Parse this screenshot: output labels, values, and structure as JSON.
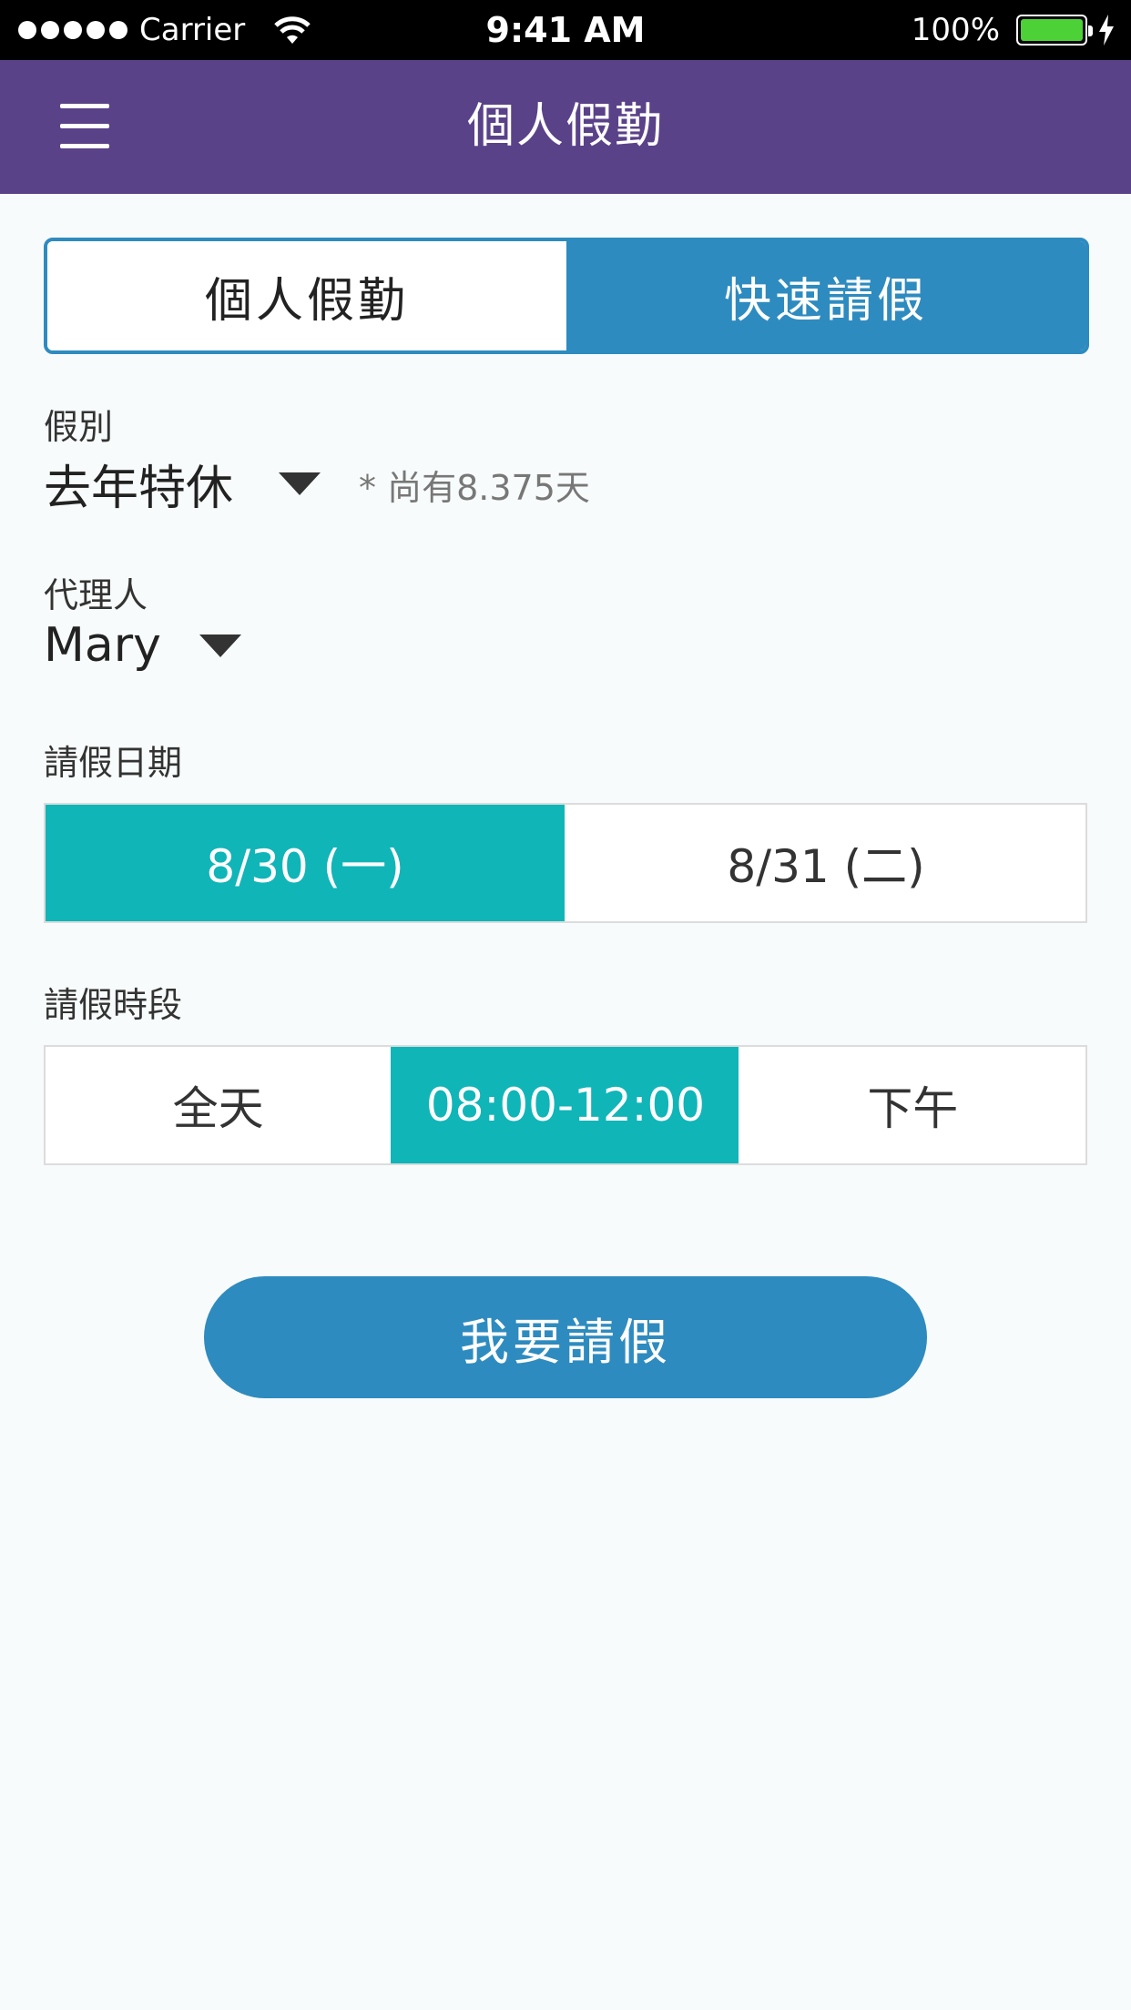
{
  "status_bar": {
    "carrier": "Carrier",
    "time": "9:41 AM",
    "battery": "100%"
  },
  "header": {
    "title": "個人假勤",
    "menu_icon": "hamburger-menu-icon"
  },
  "segmented": {
    "tabs": [
      {
        "label": "個人假勤",
        "selected": false
      },
      {
        "label": "快速請假",
        "selected": true
      }
    ]
  },
  "form": {
    "leave_type": {
      "label": "假別",
      "value": "去年特休",
      "note": "* 尚有8.375天"
    },
    "agent": {
      "label": "代理人",
      "value": "Mary"
    },
    "date": {
      "label": "請假日期",
      "options": [
        {
          "label": "8/30 (一)",
          "selected": true
        },
        {
          "label": "8/31 (二)",
          "selected": false
        }
      ]
    },
    "period": {
      "label": "請假時段",
      "options": [
        {
          "label": "全天",
          "selected": false
        },
        {
          "label": "08:00-12:00",
          "selected": true
        },
        {
          "label": "下午",
          "selected": false
        }
      ]
    }
  },
  "submit_label": "我要請假",
  "colors": {
    "nav": "#5a4289",
    "primary": "#2e8bbf",
    "selected": "#10b5b8",
    "background": "#f8fbfb"
  }
}
